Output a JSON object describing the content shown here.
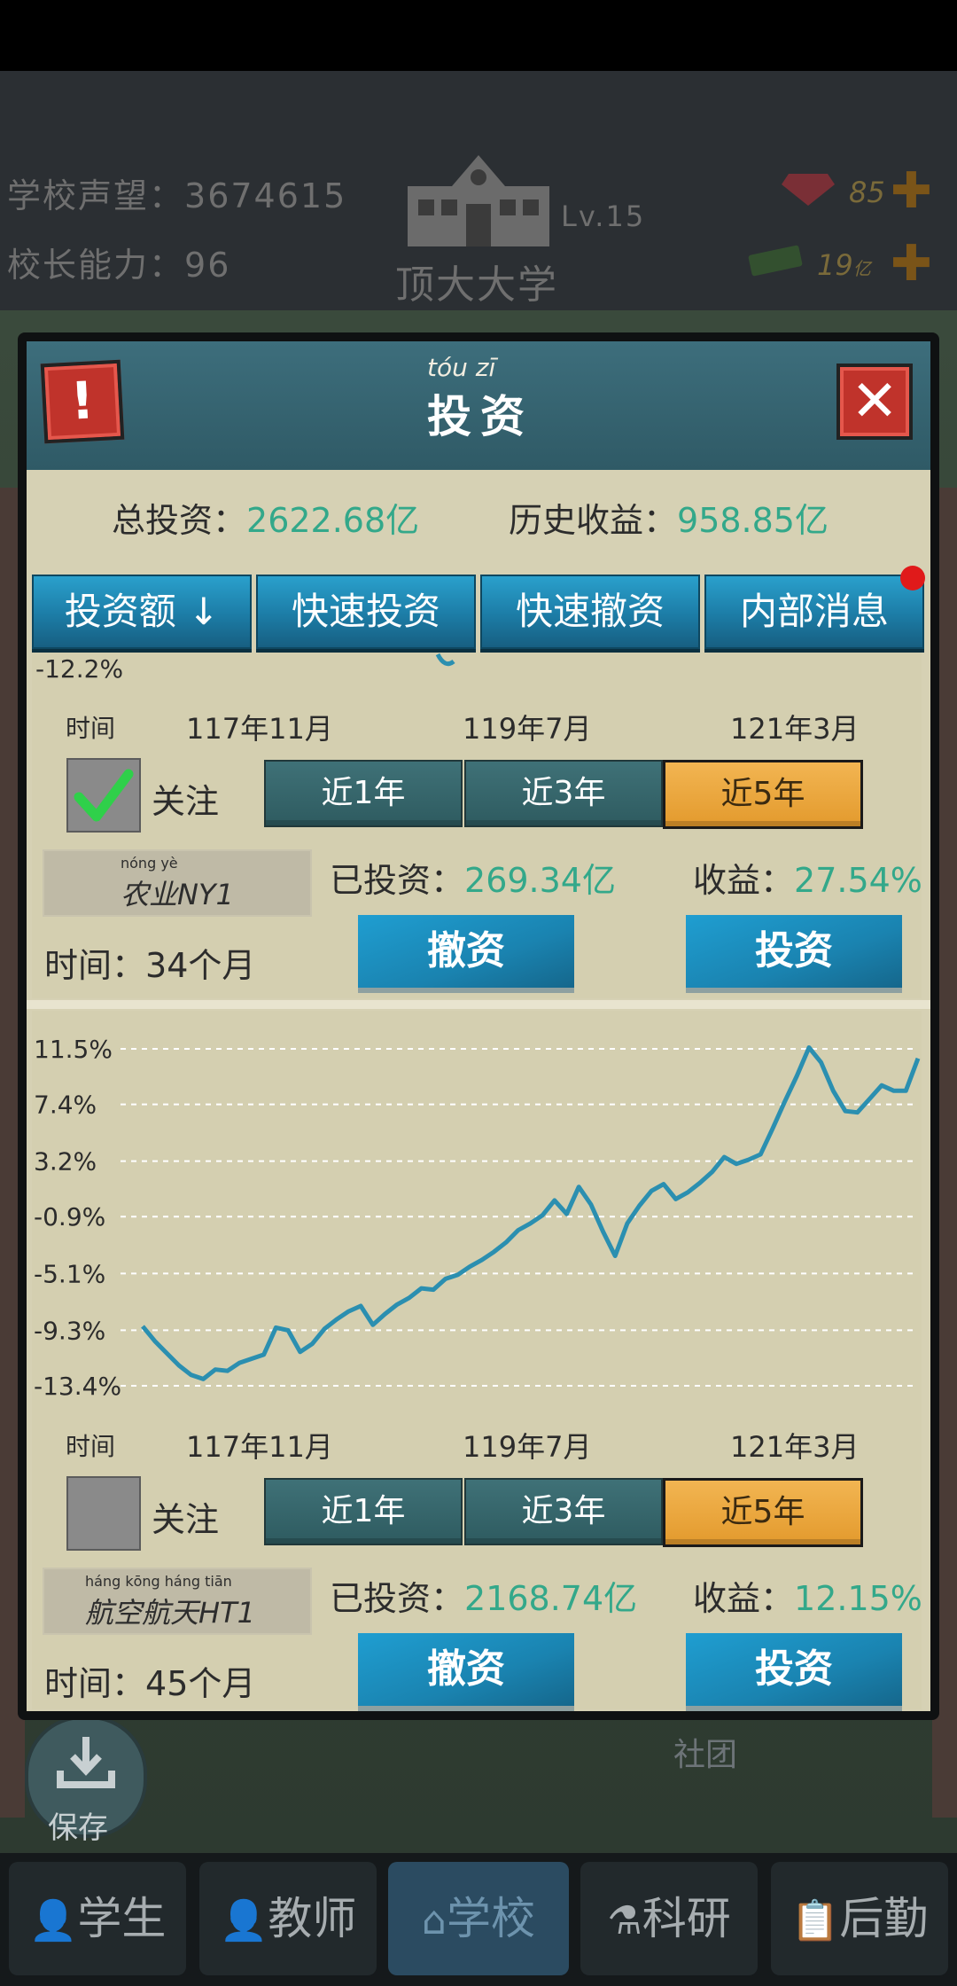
{
  "header": {
    "reputation_label": "学校声望：",
    "reputation_value": "3674615",
    "ability_label": "校长能力：",
    "ability_value": "96",
    "level": "Lv.15",
    "school_name": "顶大大学",
    "gems": "85",
    "money": "19",
    "money_unit": "亿"
  },
  "dialog": {
    "title_pinyin": "tóu  zī",
    "title": "投资",
    "total_invest_label": "总投资：",
    "total_invest_value": "2622.68亿",
    "history_profit_label": "历史收益：",
    "history_profit_value": "958.85亿",
    "tabs": [
      "投资额 ↓",
      "快速投资",
      "快速撤资",
      "内部消息"
    ],
    "colors": {
      "accent": "#33a88a",
      "line": "#2b8fb0",
      "active_period": "#e9a43a",
      "badge": "#e01a1a"
    }
  },
  "cards": [
    {
      "partial_top_tick": "-12.2%",
      "x_axis_title": "时间",
      "x_ticks": [
        "117年11月",
        "119年7月",
        "121年3月"
      ],
      "watch_label": "关注",
      "watched": true,
      "periods": [
        "近1年",
        "近3年",
        "近5年"
      ],
      "active_period": "近5年",
      "name_pinyin": "nóng yè",
      "name": "农业NY1",
      "invested_label": "已投资：",
      "invested_value": "269.34亿",
      "profit_label": "收益：",
      "profit_value": "27.54%",
      "duration_label": "时间：",
      "duration_value": "34个月",
      "withdraw_label": "撤资",
      "invest_label": "投资"
    },
    {
      "x_axis_title": "时间",
      "x_ticks": [
        "117年11月",
        "119年7月",
        "121年3月"
      ],
      "watch_label": "关注",
      "watched": false,
      "periods": [
        "近1年",
        "近3年",
        "近5年"
      ],
      "active_period": "近5年",
      "name_pinyin": "háng kōng háng tiān",
      "name": "航空航天HT1",
      "invested_label": "已投资：",
      "invested_value": "2168.74亿",
      "profit_label": "收益：",
      "profit_value": "12.15%",
      "duration_label": "时间：",
      "duration_value": "45个月",
      "withdraw_label": "撤资",
      "invest_label": "投资"
    }
  ],
  "chart_data": {
    "type": "line",
    "title": "",
    "xlabel": "时间",
    "ylabel": "",
    "y_ticks": [
      "11.5%",
      "7.4%",
      "3.2%",
      "-0.9%",
      "-5.1%",
      "-9.3%",
      "-13.4%"
    ],
    "y_tick_values": [
      11.5,
      7.4,
      3.2,
      -0.9,
      -5.1,
      -9.3,
      -13.4
    ],
    "ylim": [
      -13.4,
      11.5
    ],
    "x_ticks": [
      "117年11月",
      "119年7月",
      "121年3月"
    ],
    "grid": true,
    "series": [
      {
        "values": [
          -9.0,
          -10.1,
          -11.0,
          -11.9,
          -12.6,
          -12.9,
          -12.2,
          -12.3,
          -11.7,
          -11.4,
          -11.1,
          -9.1,
          -9.3,
          -10.9,
          -10.3,
          -9.2,
          -8.5,
          -7.9,
          -7.5,
          -8.9,
          -8.1,
          -7.4,
          -6.9,
          -6.2,
          -6.3,
          -5.5,
          -5.2,
          -4.6,
          -4.1,
          -3.5,
          -2.8,
          -1.9,
          -1.4,
          -0.8,
          0.3,
          -0.7,
          1.3,
          0.0,
          -2.0,
          -3.8,
          -1.4,
          -0.1,
          1.0,
          1.5,
          0.4,
          0.9,
          1.6,
          2.4,
          3.5,
          3.0,
          3.3,
          3.7,
          5.6,
          7.6,
          9.5,
          11.6,
          10.5,
          8.4,
          6.9,
          6.8,
          7.8,
          8.8,
          8.4,
          8.4,
          10.8
        ]
      }
    ]
  },
  "save_label": "保存",
  "club_label": "社团",
  "nav": [
    "学生",
    "教师",
    "学校",
    "科研",
    "后勤"
  ],
  "nav_active": "学校"
}
